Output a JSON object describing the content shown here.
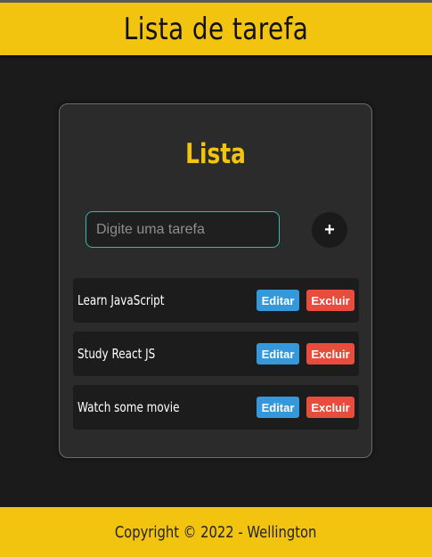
{
  "header": {
    "title": "Lista de tarefa"
  },
  "card": {
    "title": "Lista",
    "input": {
      "placeholder": "Digite uma tarefa",
      "value": ""
    },
    "add_button_label": "+"
  },
  "tasks": [
    {
      "text": "Learn JavaScript",
      "edit_label": "Editar",
      "delete_label": "Excluir"
    },
    {
      "text": "Study React JS",
      "edit_label": "Editar",
      "delete_label": "Excluir"
    },
    {
      "text": "Watch some movie",
      "edit_label": "Editar",
      "delete_label": "Excluir"
    }
  ],
  "footer": {
    "text": "Copyright © 2022 - Wellington"
  },
  "colors": {
    "accent": "#f2c40f",
    "edit": "#3498db",
    "delete": "#e74c3c",
    "input_border": "#3fb8a0"
  }
}
